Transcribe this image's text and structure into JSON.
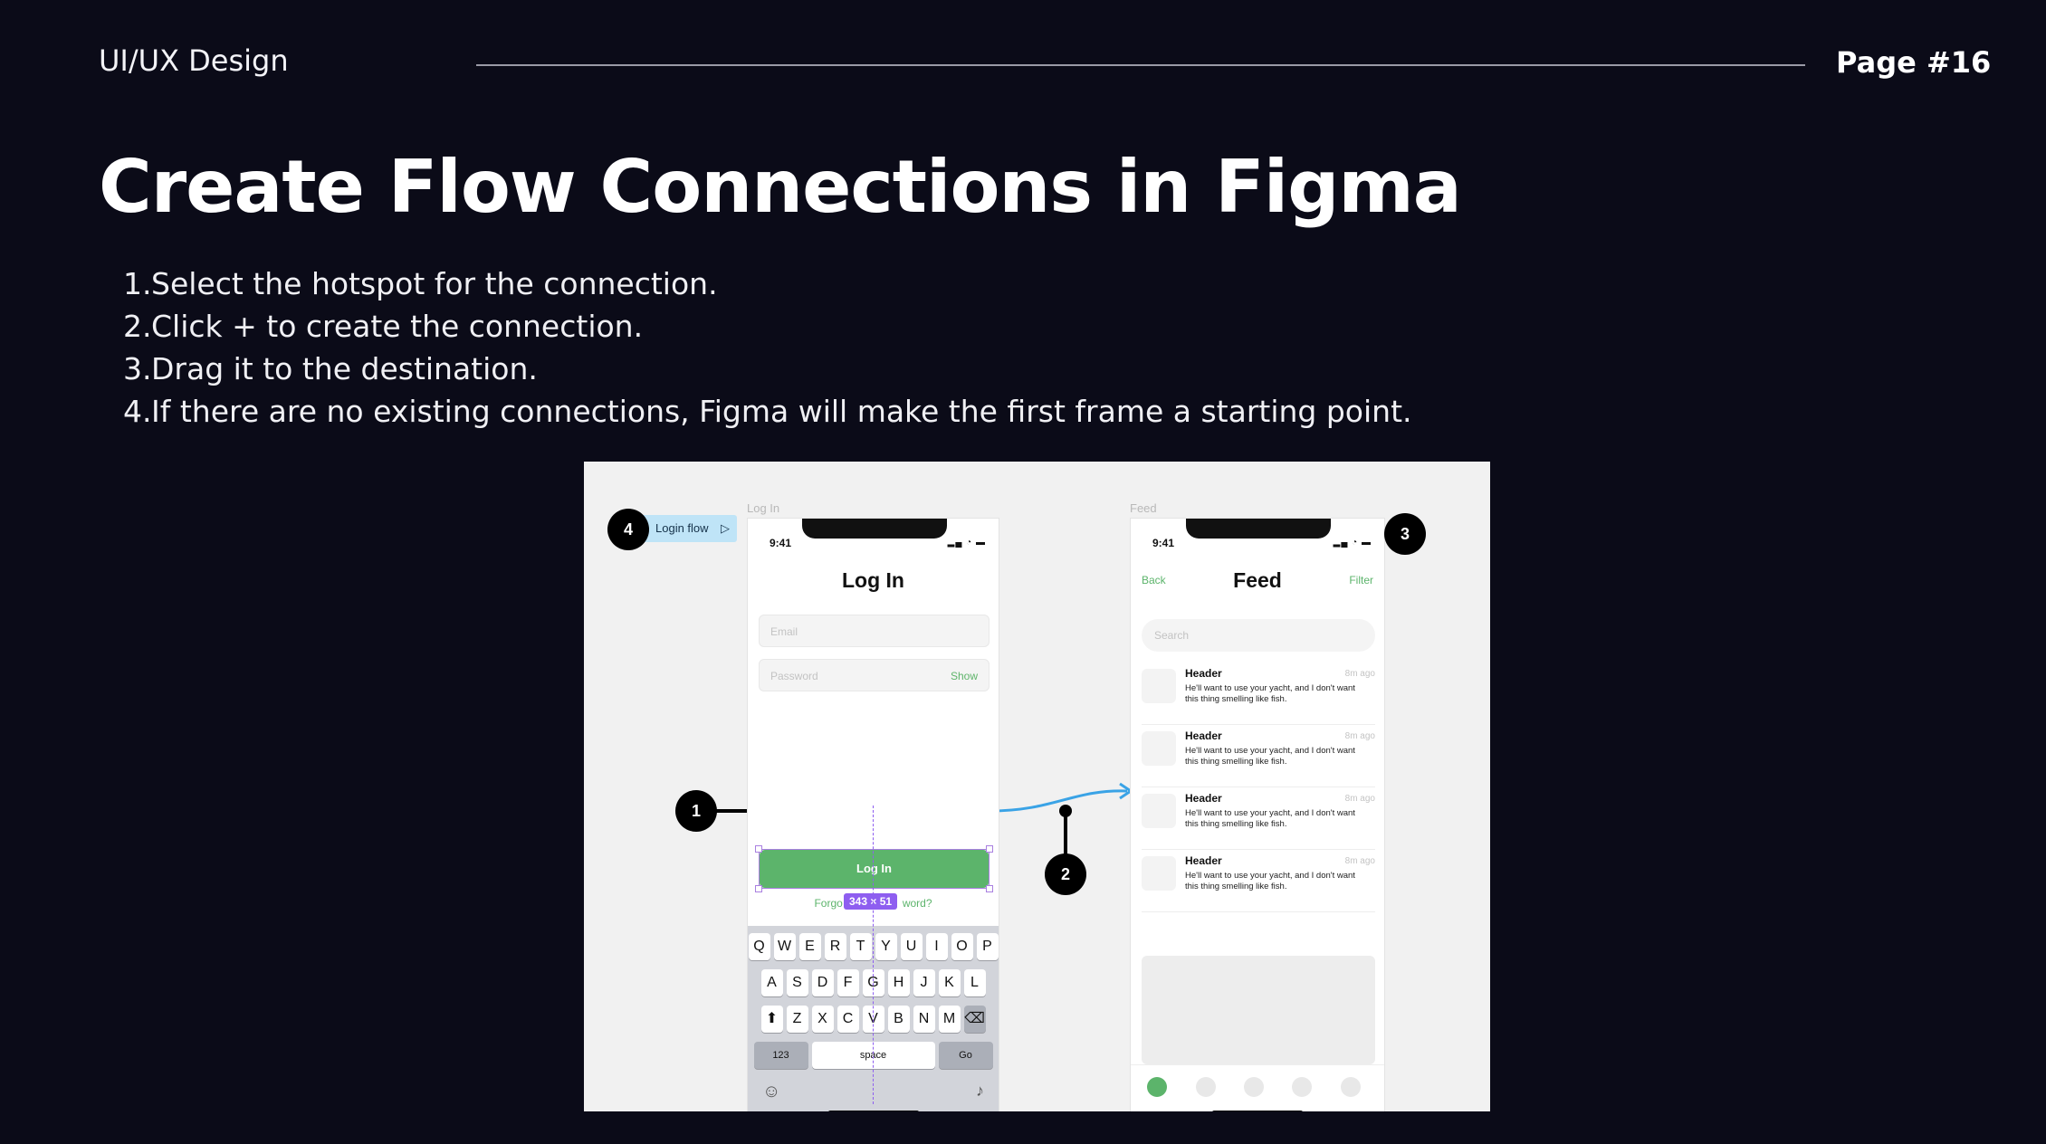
{
  "header": {
    "course": "UI/UX Design",
    "page": "Page #16"
  },
  "title": "Create Flow Connections in Figma",
  "steps": [
    {
      "num": "1.",
      "text": "Select the hotspot for the connection."
    },
    {
      "num": "2.",
      "text": "Click + to create the connection."
    },
    {
      "num": "3.",
      "text": "Drag it to the destination."
    },
    {
      "num": "4.",
      "text": "If there are no existing connections, Figma will make the first frame a starting point."
    }
  ],
  "illustration": {
    "flow_label": "Login flow",
    "badges": [
      "1",
      "2",
      "3",
      "4"
    ],
    "login_frame": {
      "frame_label": "Log In",
      "time": "9:41",
      "title": "Log In",
      "email_placeholder": "Email",
      "password_placeholder": "Password",
      "show_label": "Show",
      "button_label": "Log In",
      "forgot_left": "Forgo",
      "forgot_right": "word?",
      "dimensions": "343 × 51",
      "keyboard_row1": [
        "Q",
        "W",
        "E",
        "R",
        "T",
        "Y",
        "U",
        "I",
        "O",
        "P"
      ],
      "keyboard_row2": [
        "A",
        "S",
        "D",
        "F",
        "G",
        "H",
        "J",
        "K",
        "L"
      ],
      "keyboard_row3": [
        "Z",
        "X",
        "C",
        "V",
        "B",
        "N",
        "M"
      ],
      "key_123": "123",
      "key_space": "space",
      "key_go": "Go"
    },
    "feed_frame": {
      "frame_label": "Feed",
      "time": "9:41",
      "back": "Back",
      "title": "Feed",
      "filter": "Filter",
      "search_placeholder": "Search",
      "items": [
        {
          "header": "Header",
          "time": "8m ago",
          "body": "He'll want to use your yacht, and I don't want this thing smelling like fish."
        },
        {
          "header": "Header",
          "time": "8m ago",
          "body": "He'll want to use your yacht, and I don't want this thing smelling like fish."
        },
        {
          "header": "Header",
          "time": "8m ago",
          "body": "He'll want to use your yacht, and I don't want this thing smelling like fish."
        },
        {
          "header": "Header",
          "time": "8m ago",
          "body": "He'll want to use your yacht, and I don't want this thing smelling like fish."
        }
      ]
    },
    "colors": {
      "accent_green": "#5cb46b",
      "connector_blue": "#3aa3e6",
      "selection_purple": "#8e5ef0"
    }
  }
}
